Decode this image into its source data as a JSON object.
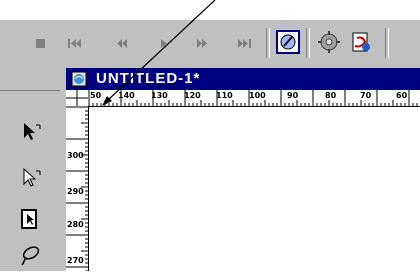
{
  "toolbar": {
    "buttons": [
      {
        "name": "stop-button",
        "glyph": "■"
      },
      {
        "name": "rewind-button",
        "glyph": "|◀◀"
      },
      {
        "name": "step-back-button",
        "glyph": "◀◀"
      },
      {
        "name": "play-button",
        "glyph": "▶"
      },
      {
        "name": "step-forward-button",
        "glyph": "▶▶"
      },
      {
        "name": "fast-forward-button",
        "glyph": "▶▶|"
      }
    ],
    "icons": [
      "animation-script-icon",
      "gear-settings-icon",
      "tool-script-icon"
    ]
  },
  "tools": {
    "items": [
      "arrow-tool-icon",
      "subselect-tool-icon",
      "page-tool-icon",
      "lasso-tool-icon"
    ]
  },
  "document": {
    "title": "UNTITLED-1*"
  },
  "rulers": {
    "horizontal": [
      "50",
      "140",
      "130",
      "120",
      "110",
      "100",
      "90",
      "80",
      "70",
      "60"
    ],
    "vertical": [
      "300",
      "290",
      "280",
      "270"
    ]
  }
}
